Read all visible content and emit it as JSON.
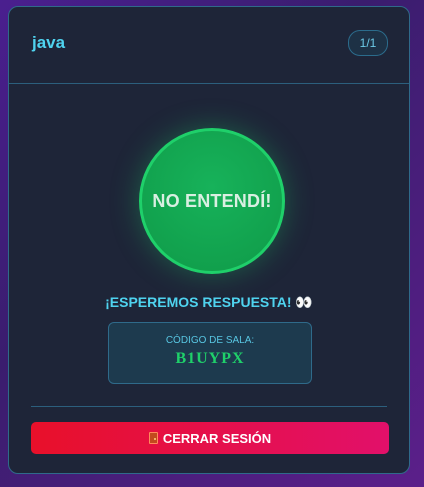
{
  "header": {
    "title": "java",
    "badge": "1/1"
  },
  "main": {
    "answer_button_label": "NO ENTENDÍ!",
    "waiting_text": "¡ESPEREMOS RESPUESTA! 👀",
    "room": {
      "label": "CÓDIGO DE SALA:",
      "code": "B1UYPX"
    }
  },
  "footer": {
    "logout_label": "CERRAR SESIÓN",
    "logout_icon": "door-icon"
  },
  "colors": {
    "accent": "#4fd3ef",
    "success": "#1fd06a",
    "danger": "#e8102a"
  }
}
